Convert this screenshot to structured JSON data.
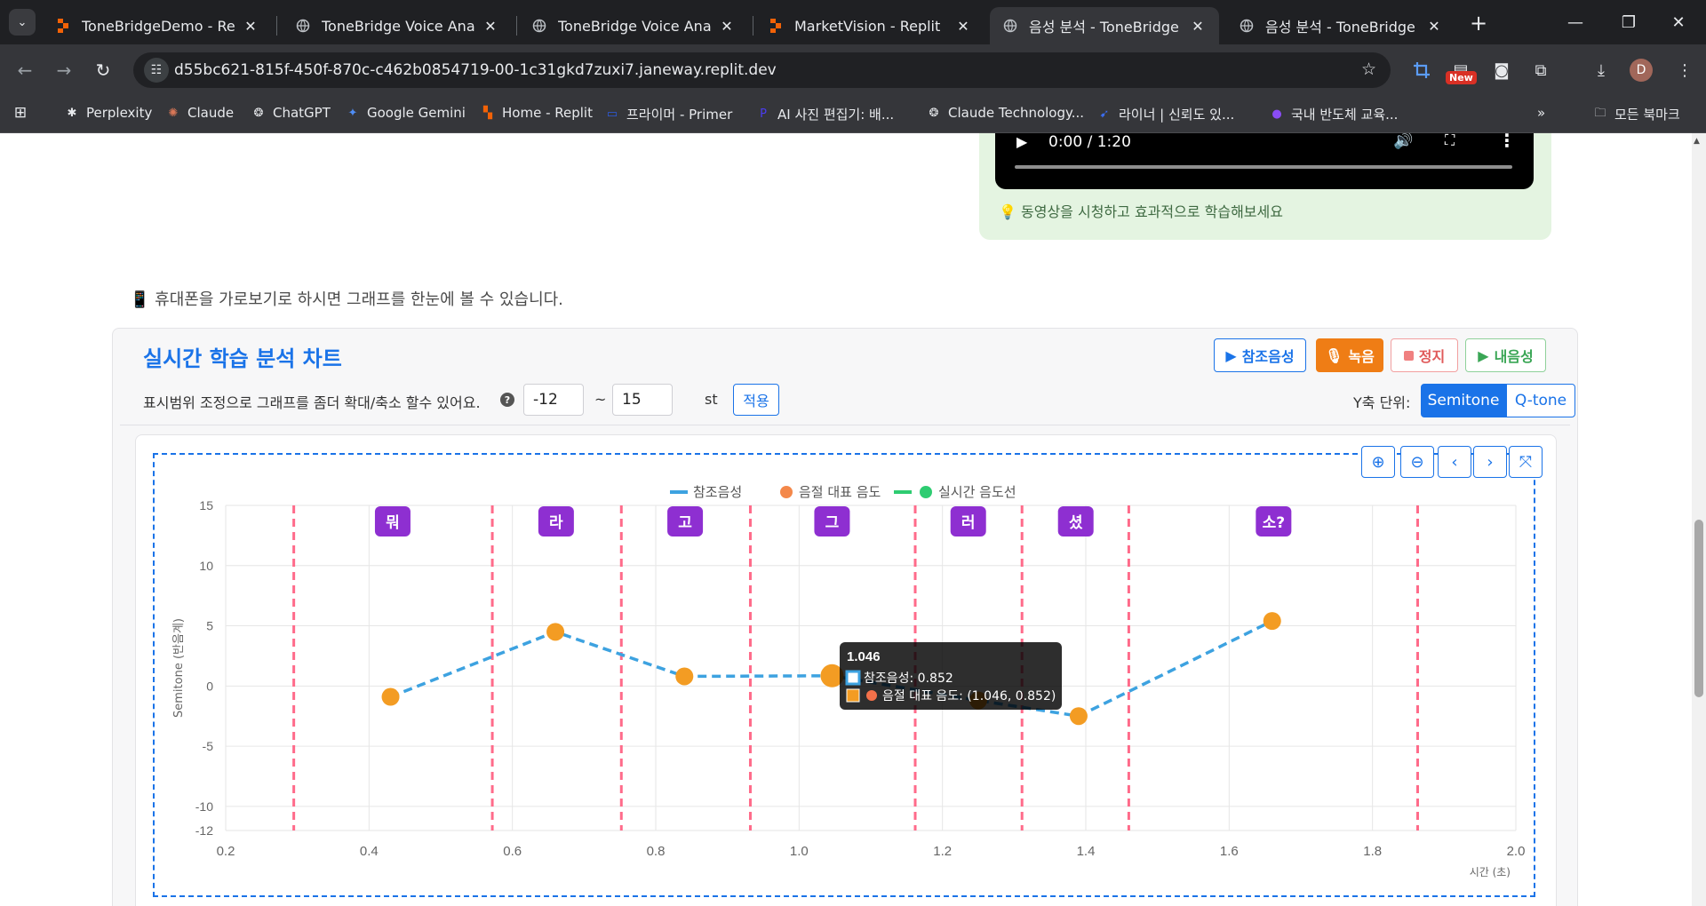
{
  "browser": {
    "tabs": [
      {
        "title": "ToneBridgeDemo - Replit",
        "icon": "replit-icon"
      },
      {
        "title": "ToneBridge Voice Analysis",
        "icon": "globe-icon"
      },
      {
        "title": "ToneBridge Voice Analysis",
        "icon": "globe-icon"
      },
      {
        "title": "MarketVision - Replit",
        "icon": "replit-icon"
      },
      {
        "title": "음성 분석 - ToneBridge",
        "icon": "globe-icon",
        "active": true
      },
      {
        "title": "음성 분석 - ToneBridge",
        "icon": "globe-icon"
      }
    ],
    "url": "d55bc621-815f-450f-870c-c462b0854719-00-1c31gkd7zuxi7.janeway.replit.dev",
    "new_badge": "New",
    "profile_initial": "D",
    "bookmarks": [
      {
        "label": "Perplexity",
        "icon": "perplexity-icon"
      },
      {
        "label": "Claude",
        "icon": "claude-icon"
      },
      {
        "label": "ChatGPT",
        "icon": "chatgpt-icon"
      },
      {
        "label": "Google Gemini",
        "icon": "gemini-icon"
      },
      {
        "label": "Home - Replit",
        "icon": "replit-icon"
      },
      {
        "label": "프라이머 - Primer",
        "icon": "primer-icon"
      },
      {
        "label": "AI 사진 편집기: 배...",
        "icon": "photo-editor-icon"
      },
      {
        "label": "Claude Technology...",
        "icon": "chatgpt-icon"
      },
      {
        "label": "라이너 | 신뢰도 있...",
        "icon": "liner-icon"
      },
      {
        "label": "국내 반도체 교육...",
        "icon": "semiconductor-icon"
      }
    ],
    "all_bookmarks": "모든 북마크"
  },
  "video": {
    "time": "0:00 / 1:20",
    "tip": "💡 동영상을 시청하고 효과적으로 학습해보세요"
  },
  "phone_tip": "📱 휴대폰을 가로보기로 하시면 그래프를 한눈에 볼 수 있습니다.",
  "panel": {
    "title": "실시간 학습 분석 차트",
    "buttons": {
      "reference": "참조음성",
      "record": "녹음",
      "stop": "정지",
      "my_voice": "내음성"
    },
    "range_label": "표시범위 조정으로 그래프를 좀더 확대/축소 할수 있어요.",
    "range_min": "-12",
    "range_sep": "~",
    "range_max": "15",
    "range_unit": "st",
    "apply": "적용",
    "y_unit_label": "Y축 단위:",
    "units": [
      "Semitone",
      "Q-tone"
    ],
    "selected_unit": "Semitone"
  },
  "colors": {
    "accent": "#1a73e8",
    "reference_line": "#3da2e0",
    "syllable_point": "#f39c23",
    "realtime_line": "#2ecc71",
    "boundary": "#ff6b8a",
    "syllable_badge": "#8e2fd1"
  },
  "chart_data": {
    "type": "line",
    "xlabel": "시간 (초)",
    "ylabel": "Semitone (반음계)",
    "xlim": [
      0.2,
      2.0
    ],
    "ylim": [
      -12,
      15
    ],
    "x_ticks": [
      "0.2",
      "0.4",
      "0.6",
      "0.8",
      "1.0",
      "1.2",
      "1.4",
      "1.6",
      "1.8",
      "2.0"
    ],
    "y_ticks": [
      "15",
      "10",
      "5",
      "0",
      "-5",
      "-10",
      "-12"
    ],
    "legend": [
      "참조음성",
      "음절 대표 음도",
      "실시간 음도선"
    ],
    "legend_position": "top-center",
    "series": [
      {
        "name": "참조음성",
        "points": [
          [
            0.43,
            -0.9
          ],
          [
            0.66,
            4.5
          ],
          [
            0.84,
            0.8
          ],
          [
            1.046,
            0.852
          ],
          [
            1.25,
            -1.2
          ],
          [
            1.39,
            -2.5
          ],
          [
            1.66,
            5.4
          ]
        ]
      },
      {
        "name": "음절 대표 음도",
        "points": [
          [
            0.43,
            -0.9
          ],
          [
            0.66,
            4.5
          ],
          [
            0.84,
            0.8
          ],
          [
            1.046,
            0.852
          ],
          [
            1.25,
            -1.2
          ],
          [
            1.39,
            -2.5
          ],
          [
            1.66,
            5.4
          ]
        ]
      }
    ],
    "boundaries": [
      0.295,
      0.572,
      0.752,
      0.932,
      1.162,
      1.311,
      1.46,
      1.863
    ],
    "syllables": [
      {
        "text": "뭐",
        "x": 0.433
      },
      {
        "text": "라",
        "x": 0.661
      },
      {
        "text": "고",
        "x": 0.841
      },
      {
        "text": "그",
        "x": 1.046
      },
      {
        "text": "러",
        "x": 1.236
      },
      {
        "text": "셨",
        "x": 1.386
      },
      {
        "text": "소?",
        "x": 1.662
      }
    ],
    "tooltip": {
      "title": "1.046",
      "line1": "참조음성: 0.852",
      "line2": "음절 대표 음도: (1.046, 0.852)"
    }
  }
}
